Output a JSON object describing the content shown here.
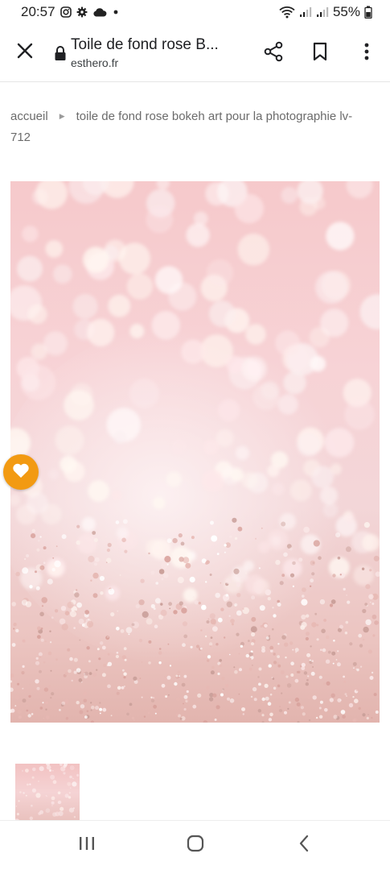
{
  "status_bar": {
    "time": "20:57",
    "battery": "55%",
    "icons": [
      "instagram-icon",
      "settings-icon",
      "cloud-icon",
      "dot-icon",
      "wifi-icon",
      "signal-icon",
      "signal-icon",
      "battery-icon"
    ]
  },
  "toolbar": {
    "title": "Toile de fond rose B...",
    "url": "esthero.fr",
    "icons": [
      "close-icon",
      "lock-icon",
      "share-icon",
      "bookmark-icon",
      "more-vert-icon"
    ]
  },
  "breadcrumb": {
    "home": "accueil",
    "current": "toile de fond rose bokeh art pour la photographie lv-712"
  },
  "product": {
    "wishlist_icon": "heart-icon",
    "accent_color": "#f29a12"
  },
  "nav_bar": {
    "icons": [
      "recent-apps-icon",
      "home-icon",
      "back-icon"
    ]
  }
}
